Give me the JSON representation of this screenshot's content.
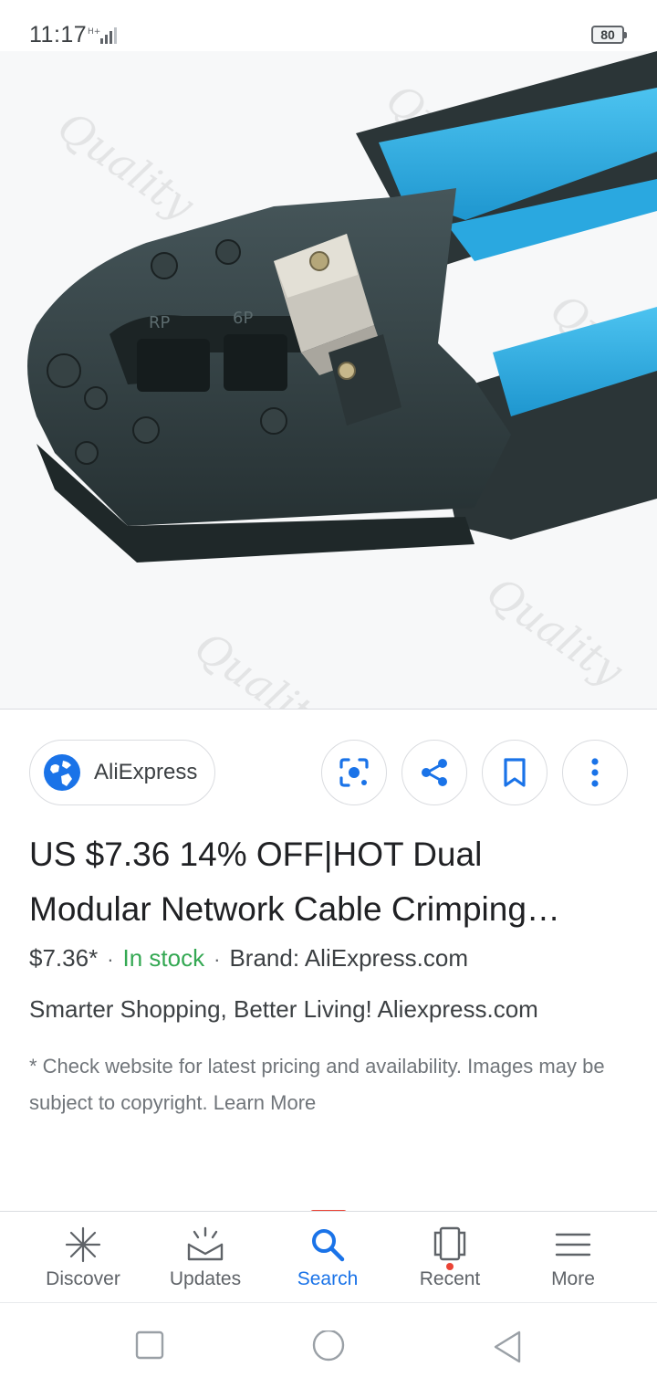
{
  "status_bar": {
    "time": "11:17",
    "network": "H+",
    "battery": "80"
  },
  "hero_image": {
    "alt": "Blue and black modular crimping tool",
    "label_left": "RP",
    "label_right": "6P"
  },
  "source": {
    "name": "AliExpress",
    "icon": "globe-icon"
  },
  "actions": {
    "lens": "lens-icon",
    "share": "share-icon",
    "save": "bookmark-icon",
    "more": "more-vert-icon"
  },
  "product": {
    "title_line1": "US $7.36 14% OFF|HOT Dual",
    "title_line2": "Modular Network Cable Crimping…",
    "price": "$7.36*",
    "stock": "In stock",
    "brand": "Brand: AliExpress.com",
    "subtitle": "Smarter Shopping, Better Living! Aliexpress.com",
    "disclaimer": "* Check website for latest pricing and availability. Images may be subject to copyright. Learn More"
  },
  "bottom_nav": {
    "items": [
      {
        "label": "Discover",
        "icon": "asterisk-icon"
      },
      {
        "label": "Updates",
        "icon": "tray-icon"
      },
      {
        "label": "Search",
        "icon": "search-icon"
      },
      {
        "label": "Recent",
        "icon": "cards-icon"
      },
      {
        "label": "More",
        "icon": "menu-icon"
      }
    ],
    "active": "Search"
  },
  "colors": {
    "accent": "#1a73e8",
    "stock": "#34a853",
    "tool_blue": "#2aa8e0",
    "tool_dark": "#2f3a3c"
  }
}
